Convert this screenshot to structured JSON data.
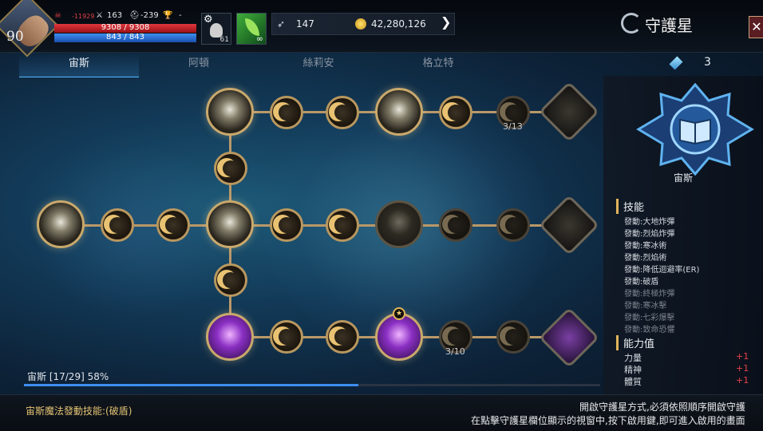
{
  "player": {
    "level": "90",
    "stat_karma": "-11929",
    "stat_attack": "163",
    "stat_defense": "-239",
    "stat_trophy": "-",
    "hp": "9308 / 9308",
    "mp": "843 / 843",
    "pet_count": "61",
    "buff_label": "∞"
  },
  "currency": {
    "feather": "147",
    "gold": "42,280,126"
  },
  "window": {
    "title": "守護星",
    "close_glyph": "✕"
  },
  "tabs": [
    {
      "label": "宙斯",
      "active": true
    },
    {
      "label": "阿頓",
      "active": false
    },
    {
      "label": "絲莉安",
      "active": false
    },
    {
      "label": "格立特",
      "active": false
    }
  ],
  "tree": {
    "count_top": "3/13",
    "count_bottom": "3/10"
  },
  "progress": {
    "label": "宙斯 [17/29] 58%",
    "fraction": 0.58
  },
  "panel": {
    "crystals": "3",
    "constellation_name": "宙斯",
    "skills_header": "技能",
    "skills": [
      {
        "label": "發動:大地炸彈",
        "unlocked": true
      },
      {
        "label": "發動:烈焰炸彈",
        "unlocked": true
      },
      {
        "label": "發動:寒冰術",
        "unlocked": true
      },
      {
        "label": "發動:烈焰術",
        "unlocked": true
      },
      {
        "label": "發動:降低迴避率(ER)",
        "unlocked": true
      },
      {
        "label": "發動:破盾",
        "unlocked": true
      },
      {
        "label": "發動:終極炸彈",
        "unlocked": false
      },
      {
        "label": "發動:寒冰擊",
        "unlocked": false
      },
      {
        "label": "發動:七彩爆擊",
        "unlocked": false
      },
      {
        "label": "發動:致命恐懼",
        "unlocked": false
      }
    ],
    "attrs_header": "能力值",
    "attrs": [
      {
        "label": "力量",
        "value": "+1"
      },
      {
        "label": "精神",
        "value": "+1"
      },
      {
        "label": "體質",
        "value": "+1"
      }
    ]
  },
  "footer": {
    "active_skill": "宙斯魔法發動技能:(破盾)",
    "help_line1": "開啟守護星方式,必須依照順序開啟守護",
    "help_line2": "在點擊守護星欄位顯示的視窗中,按下啟用鍵,即可進入啟用的畫面"
  },
  "colors": {
    "hp": "#d32a30",
    "mp": "#2f7de0",
    "accent_gold": "#e0b55a",
    "progress": "#3d8ff0",
    "attr_value": "#e8414a"
  }
}
